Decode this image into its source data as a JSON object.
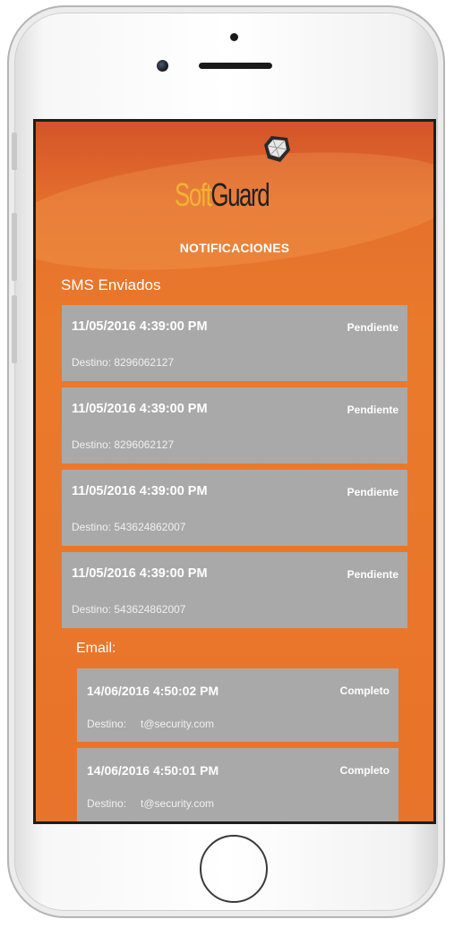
{
  "app": {
    "logo_soft": "Soft",
    "logo_guard": "Guard",
    "title": "NOTIFICACIONES"
  },
  "colors": {
    "background": "#e8732a",
    "card": "#a9a9a9",
    "logo_soft": "#f2b234",
    "logo_guard": "#1f1f1f"
  },
  "sms": {
    "label": "SMS Enviados",
    "items": [
      {
        "date": "11/05/2016 4:39:00 PM",
        "status": "Pendiente",
        "destino_label": "Destino:",
        "destino": "8296062127"
      },
      {
        "date": "11/05/2016 4:39:00 PM",
        "status": "Pendiente",
        "destino_label": "Destino:",
        "destino": "8296062127"
      },
      {
        "date": "11/05/2016 4:39:00 PM",
        "status": "Pendiente",
        "destino_label": "Destino:",
        "destino": "543624862007"
      },
      {
        "date": "11/05/2016 4:39:00 PM",
        "status": "Pendiente",
        "destino_label": "Destino:",
        "destino": "543624862007"
      }
    ]
  },
  "email": {
    "label": "Email:",
    "items": [
      {
        "date": "14/06/2016 4:50:02 PM",
        "status": "Completo",
        "destino_label": "Destino:",
        "destino": "t@security.com"
      },
      {
        "date": "14/06/2016 4:50:01 PM",
        "status": "Completo",
        "destino_label": "Destino:",
        "destino": "t@security.com"
      }
    ]
  }
}
